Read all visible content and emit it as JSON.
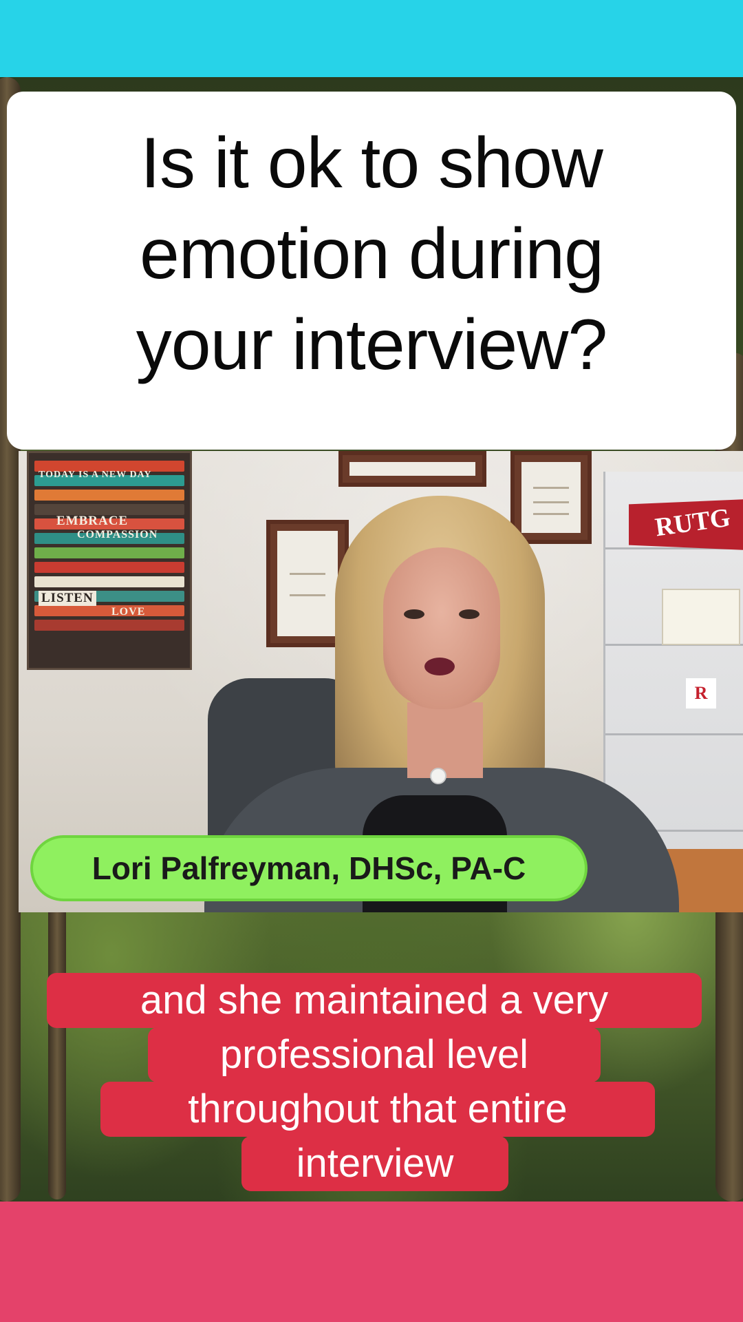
{
  "overlay": {
    "title_lines": [
      "Is it ok to show",
      "emotion during",
      "your interview?"
    ],
    "speaker_name": "Lori Palfreyman, DHSc, PA-C",
    "caption_lines": [
      "and she maintained a very",
      "professional level",
      "throughout that entire",
      "interview"
    ]
  },
  "scene": {
    "poster_words": [
      "TODAY IS A NEW DAY",
      "EMBRACE",
      "COMPASSION",
      "LISTEN",
      "LOVE"
    ],
    "pennant_text": "RUTG",
    "sticker_text": "R"
  },
  "colors": {
    "top_bar": "#27d3e8",
    "bottom_bar": "#e4426a",
    "caption_bg": "#dd2f45",
    "name_tag_bg": "#8ff05f",
    "title_card_bg": "#ffffff"
  }
}
